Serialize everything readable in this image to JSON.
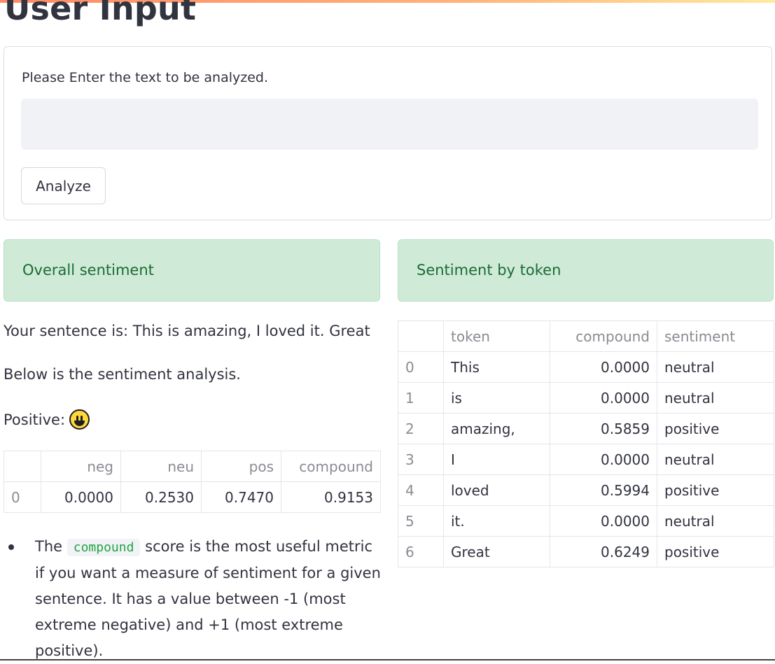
{
  "page": {
    "heading": "User Input"
  },
  "form": {
    "label": "Please Enter the text to be analyzed.",
    "input_value": "",
    "input_placeholder": "",
    "button_label": "Analyze"
  },
  "overall": {
    "title": "Overall sentiment",
    "sentence_line": "Your sentence is: This is amazing, I loved it. Great",
    "below_line": "Below is the sentiment analysis.",
    "positive_label": "Positive:",
    "emoji_icon": "grinning-face-icon",
    "table": {
      "columns": [
        "",
        "neg",
        "neu",
        "pos",
        "compound"
      ],
      "rows": [
        [
          "0",
          "0.0000",
          "0.2530",
          "0.7470",
          "0.9153"
        ]
      ]
    },
    "note": {
      "before": "The",
      "code": "compound",
      "after": "score is the most useful metric if you want a measure of sentiment for a given sentence. It has a value between -1 (most extreme negative) and +1 (most extreme positive)."
    }
  },
  "tokens": {
    "title": "Sentiment by token",
    "columns": [
      "",
      "token",
      "compound",
      "sentiment"
    ],
    "rows": [
      [
        "0",
        "This",
        "0.0000",
        "neutral"
      ],
      [
        "1",
        "is",
        "0.0000",
        "neutral"
      ],
      [
        "2",
        "amazing,",
        "0.5859",
        "positive"
      ],
      [
        "3",
        "I",
        "0.0000",
        "neutral"
      ],
      [
        "4",
        "loved",
        "0.5994",
        "positive"
      ],
      [
        "5",
        "it.",
        "0.0000",
        "neutral"
      ],
      [
        "6",
        "Great",
        "0.6249",
        "positive"
      ]
    ]
  },
  "colors": {
    "accent_gradient_start": "#ff8a65",
    "success_bg": "#cfebd7",
    "success_text": "#1b6b34",
    "code_text": "#21a344"
  }
}
